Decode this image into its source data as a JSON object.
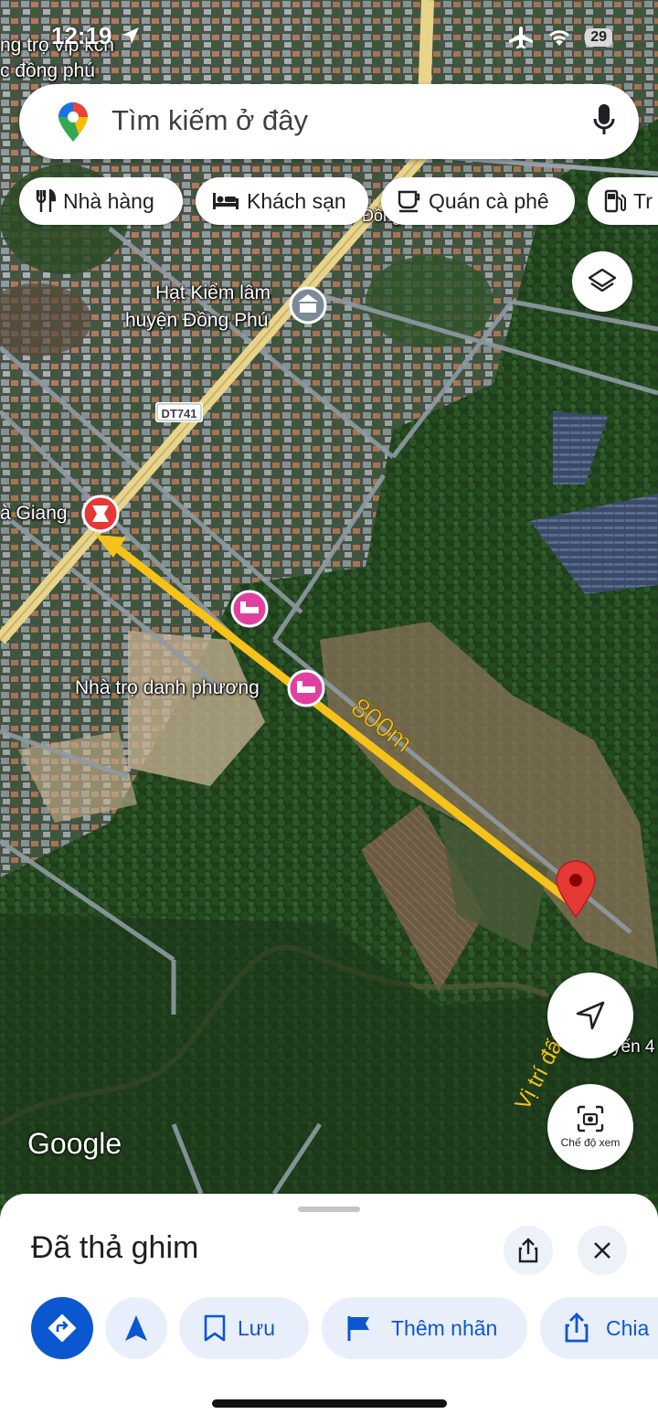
{
  "status_bar": {
    "time": "12:19",
    "battery": "29",
    "icons": [
      "location-arrow-icon",
      "airplane-icon",
      "wifi-icon",
      "battery-icon"
    ]
  },
  "search": {
    "placeholder": "Tìm kiếm ở đây",
    "icons": [
      "maps-pin-icon",
      "mic-icon"
    ]
  },
  "chips": [
    {
      "label": "Nhà hàng",
      "icon": "restaurant-icon"
    },
    {
      "label": "Khách sạn",
      "icon": "hotel-bed-icon"
    },
    {
      "label": "Quán cà phê",
      "icon": "coffee-icon"
    },
    {
      "label": "Tr",
      "icon": "gas-station-icon"
    }
  ],
  "map": {
    "labels": {
      "top_left_line1": "ng trọ vip kcn",
      "top_left_line2": "c đồng phú",
      "ranger_line1": "Hạt Kiểm lâm",
      "ranger_line2": "huyện Đồng Phú",
      "road_badge": "DT741",
      "giang": "à Giang",
      "guesthouse": "Nhà trọ danh phương",
      "partial_right": "yến 4",
      "partial_top": "Đồng"
    },
    "annotations": {
      "distance": "800m",
      "site": "Vị trí đất"
    },
    "colors": {
      "arrow": "#f7c21a",
      "pin_red": "#e53935",
      "poi_pink": "#e040a0",
      "road_yellow": "#e8d48a"
    },
    "logo": "Google"
  },
  "controls": {
    "layers_icon": "layers-icon",
    "locate_icon": "navigation-arrow-icon",
    "view_mode_label": "Chế độ xem",
    "view_mode_icon": "camera-scan-icon"
  },
  "bottom_sheet": {
    "title": "Đã thả ghim",
    "share_icon": "share-icon",
    "close_icon": "close-icon",
    "actions": [
      {
        "label": "",
        "icon": "directions-icon"
      },
      {
        "label": "",
        "icon": "navigation-start-icon"
      },
      {
        "label": "Lưu",
        "icon": "bookmark-icon"
      },
      {
        "label": "Thêm nhãn",
        "icon": "flag-icon"
      },
      {
        "label": "Chia",
        "icon": "share-icon"
      }
    ]
  }
}
